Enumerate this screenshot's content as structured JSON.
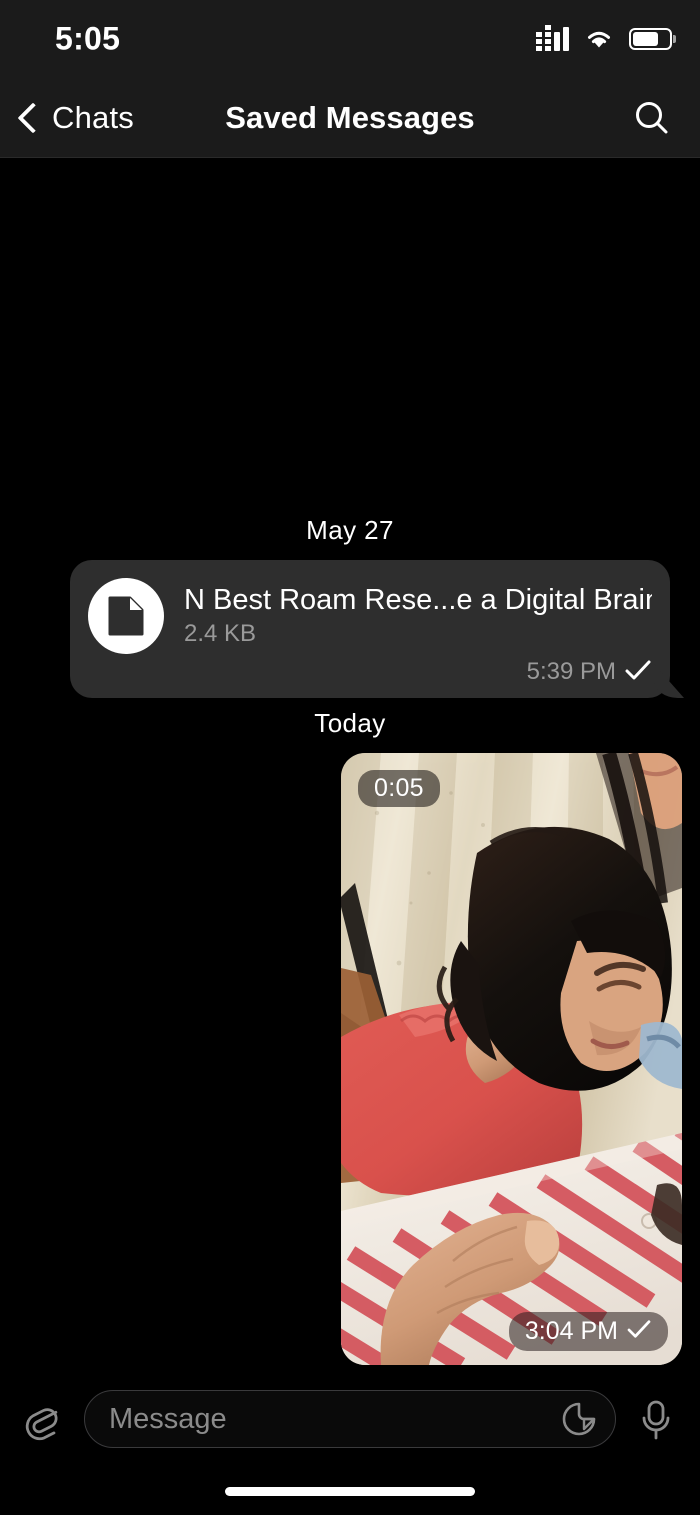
{
  "status_bar": {
    "time": "5:05",
    "cellular_icon": "cellular-signal-icon",
    "wifi_icon": "wifi-icon",
    "battery_icon": "battery-icon",
    "battery_level_pct": 72
  },
  "nav": {
    "back_icon": "chevron-left-icon",
    "back_label": "Chats",
    "title": "Saved Messages",
    "search_icon": "search-icon"
  },
  "chat": {
    "background_color": "#000000",
    "groups": [
      {
        "date_label": "May 27",
        "messages": [
          {
            "type": "file",
            "icon": "document-icon",
            "name": "N Best Roam Rese...e a Digital Brain.txt",
            "size": "2.4 KB",
            "time": "5:39 PM",
            "status_icon": "check-icon",
            "outgoing": true,
            "bubble_color": "#2e2e2e"
          }
        ]
      },
      {
        "date_label": "Today",
        "messages": [
          {
            "type": "video",
            "duration": "0:05",
            "time": "3:04 PM",
            "status_icon": "check-icon",
            "outgoing": true,
            "description": "Toddler in a red dress leaning on a red-and-white striped cushion, adult hand resting on it, beige pleated curtain behind"
          }
        ]
      }
    ]
  },
  "composer": {
    "attach_icon": "paperclip-icon",
    "placeholder": "Message",
    "value": "",
    "sticker_icon": "sticker-icon",
    "mic_icon": "microphone-icon"
  },
  "colors": {
    "header_bg": "#1b1b1b",
    "chat_bg": "#000000",
    "bubble_out": "#2e2e2e",
    "text_primary": "#ffffff",
    "text_secondary": "#9a9a9a"
  }
}
